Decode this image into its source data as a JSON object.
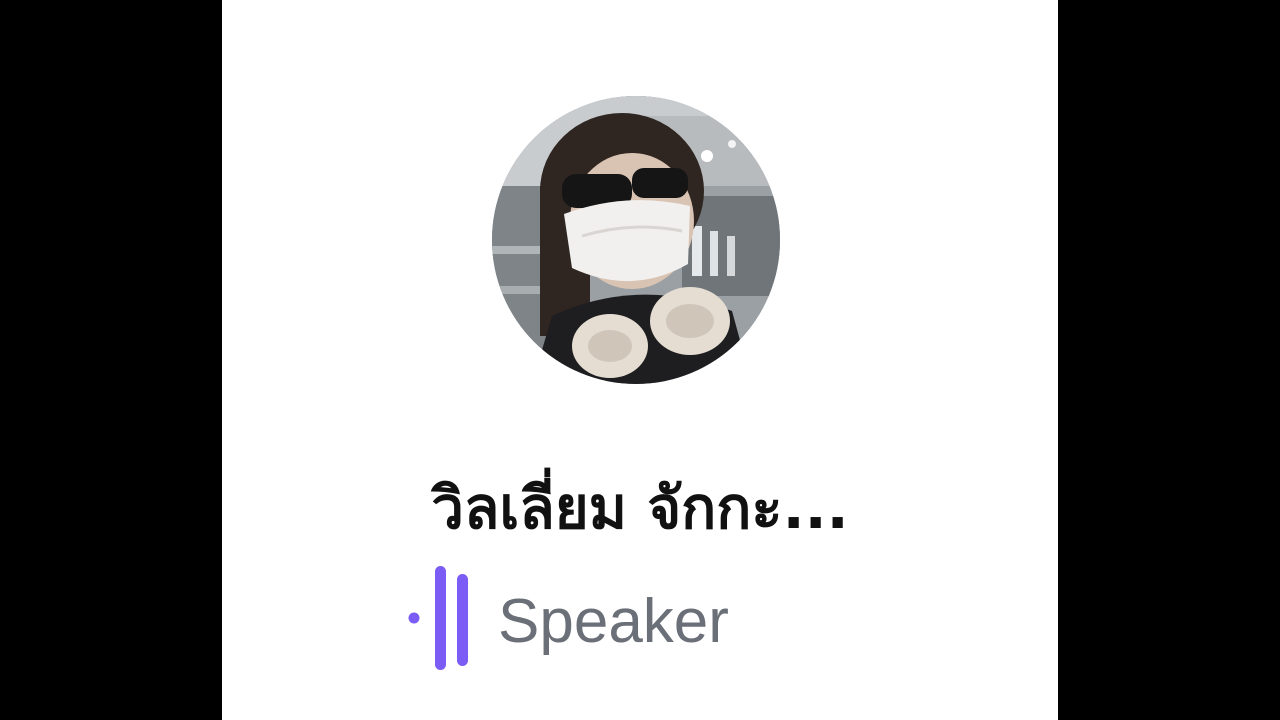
{
  "participant": {
    "display_name": "วิลเลี่ยม จักกะ...",
    "role_label": "Speaker",
    "avatar_icon": "user-photo-avatar",
    "speaker_icon": "speaking-indicator-icon"
  },
  "colors": {
    "speaker_accent": "#7b5cf5",
    "name_text": "#111111",
    "role_text": "#6b7078",
    "panel_background": "#ffffff",
    "letterbox": "#000000"
  }
}
